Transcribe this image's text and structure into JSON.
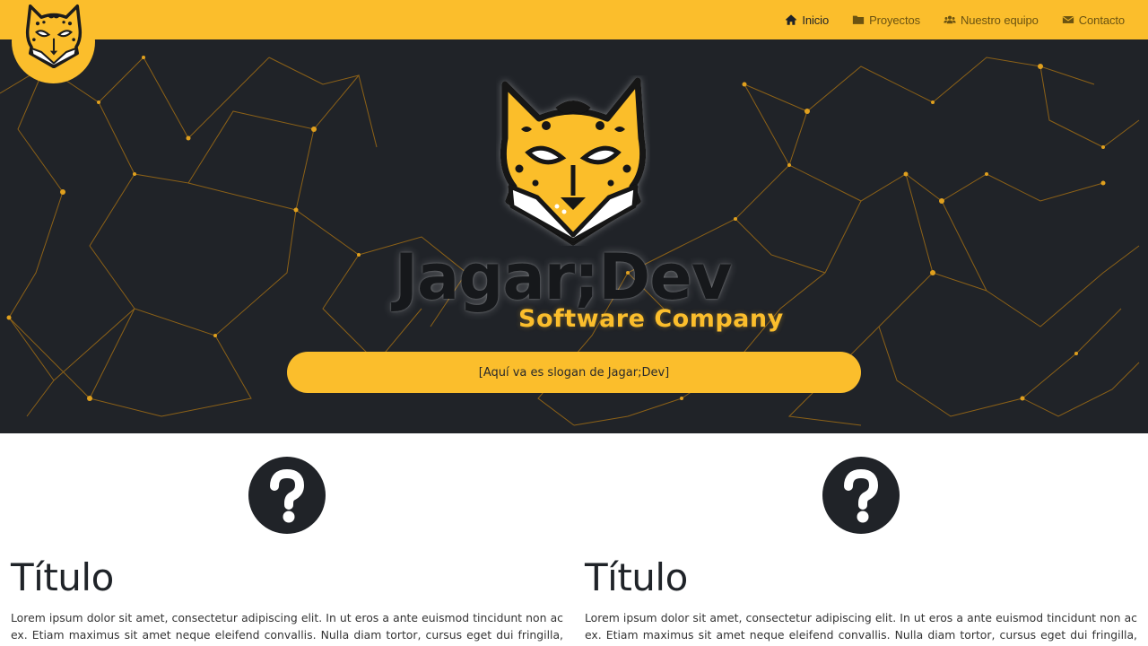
{
  "navbar": {
    "links": [
      {
        "label": "Inicio",
        "icon": "home-icon",
        "active": true
      },
      {
        "label": "Proyectos",
        "icon": "folder-icon",
        "active": false
      },
      {
        "label": "Nuestro equipo",
        "icon": "users-icon",
        "active": false
      },
      {
        "label": "Contacto",
        "icon": "envelope-icon",
        "active": false
      }
    ]
  },
  "hero": {
    "brand_title": "Jagar;Dev",
    "brand_subtitle": "Software Company",
    "slogan": "[Aquí va es slogan de Jagar;Dev]"
  },
  "features": [
    {
      "icon": "question-circle-icon",
      "title": "Título",
      "text": "Lorem ipsum dolor sit amet, consectetur adipiscing elit. In ut eros a ante euismod tincidunt non ac ex. Etiam maximus sit amet neque eleifend convallis. Nulla diam tortor, cursus eget dui fringilla, mollis vestibulum"
    },
    {
      "icon": "question-circle-icon",
      "title": "Título",
      "text": "Lorem ipsum dolor sit amet, consectetur adipiscing elit. In ut eros a ante euismod tincidunt non ac ex. Etiam maximus sit amet neque eleifend convallis. Nulla diam tortor, cursus eget dui fringilla, mollis vestibulum"
    }
  ],
  "colors": {
    "accent": "#fbbe2c",
    "dark": "#202328",
    "text_dark": "#1f2328"
  }
}
